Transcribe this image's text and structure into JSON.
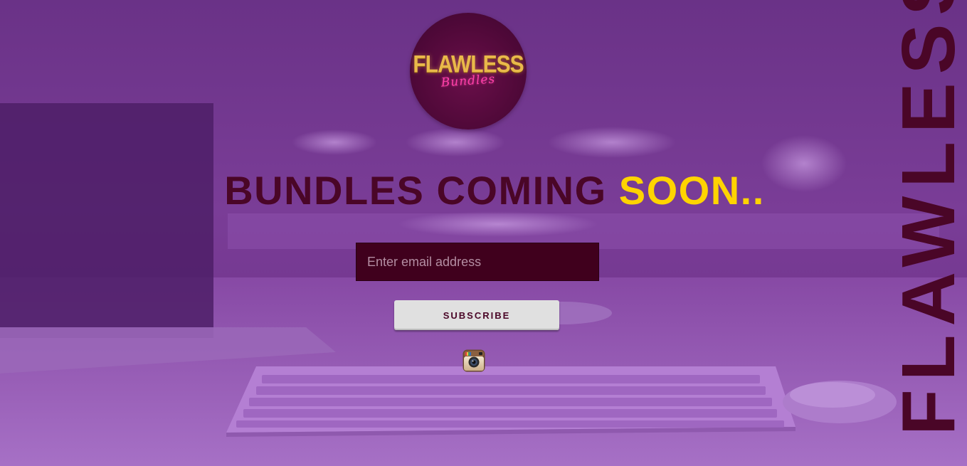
{
  "brand": {
    "logo_wordmark": "FLAWLESS",
    "logo_script": "Bundles",
    "side_word": "FLAWLESS"
  },
  "hero": {
    "heading_main": "BUNDLES COMING ",
    "heading_accent": "SOON.."
  },
  "form": {
    "email_placeholder": "Enter email address",
    "email_value": "",
    "subscribe_label": "SUBSCRIBE"
  },
  "social": {
    "icons": [
      "instagram-icon"
    ]
  },
  "colors": {
    "background_overlay": "#6b2f86",
    "heading": "#4a0627",
    "accent": "#ffd400",
    "input_bg": "#40001d",
    "button_bg": "#e0e0e0",
    "logo_gold": "#e9b94a",
    "logo_pink": "#ff3fa8"
  }
}
